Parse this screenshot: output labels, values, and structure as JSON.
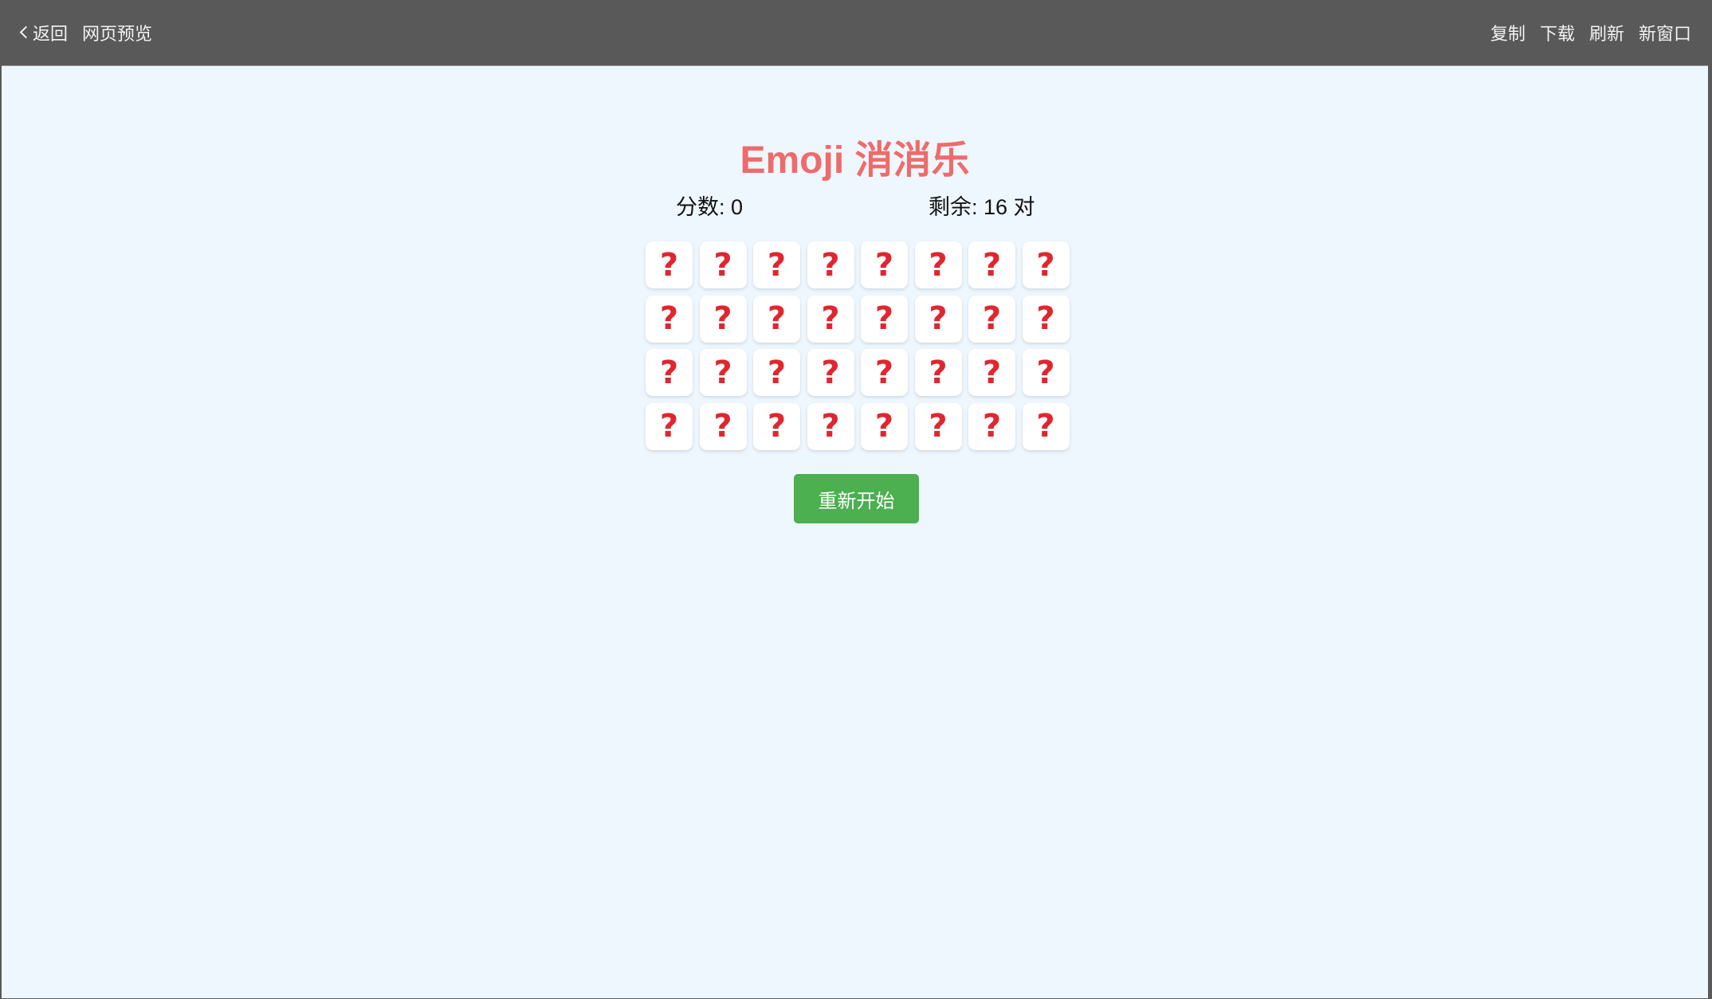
{
  "browser": {
    "back_label": "返回",
    "page_title": "网页预览",
    "actions": [
      "复制",
      "下载",
      "刷新",
      "新窗口"
    ]
  },
  "game": {
    "title": "Emoji 消消乐",
    "score_text": "分数: 0",
    "remaining_text": "剩余: 16 对",
    "restart_label": "重新开始",
    "hidden_card_icon": "red-question-mark-icon",
    "hidden_card_glyph": "?",
    "rows": 4,
    "columns": 8
  },
  "colors": {
    "title": "#ef6b6b",
    "restart_button": "#4caf50",
    "page_background": "#eef7fe",
    "topbar": "#595959",
    "question_mark": "#e0262e"
  }
}
